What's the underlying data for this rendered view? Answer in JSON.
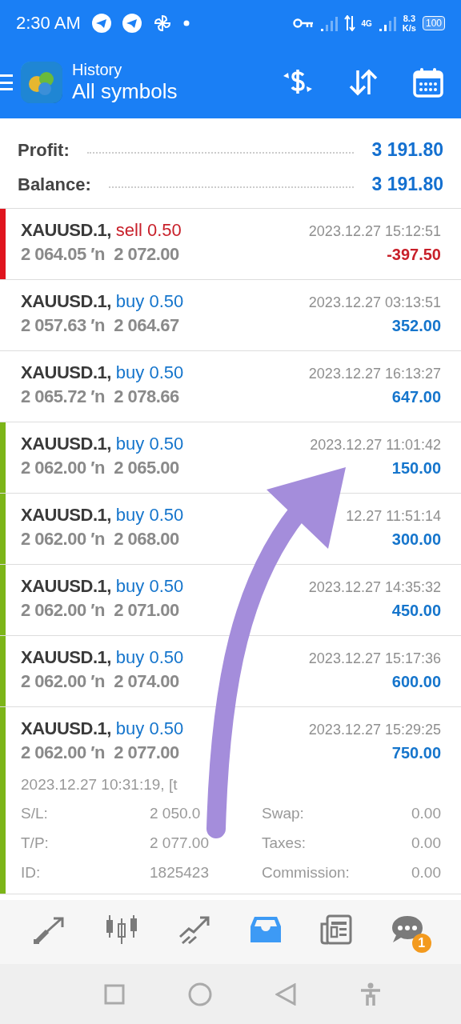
{
  "status_bar": {
    "time": "2:30 AM",
    "speed_value": "8.3",
    "speed_unit": "K/s",
    "network": "4G",
    "battery": "100"
  },
  "header": {
    "subtitle": "History",
    "title": "All symbols"
  },
  "summary": [
    {
      "label": "Profit:",
      "value": "3 191.80"
    },
    {
      "label": "Balance:",
      "value": "3 191.80"
    }
  ],
  "deals": [
    {
      "symbol": "XAUUSD.1,",
      "kind": "sell",
      "order": "sell 0.50",
      "prices": "2 064.05 ′n  2 072.00",
      "time": "2023.12.27 15:12:51",
      "profit": "-397.50",
      "color": "#e0141e",
      "expanded": false
    },
    {
      "symbol": "XAUUSD.1,",
      "kind": "buy",
      "order": "buy 0.50",
      "prices": "2 057.63 ′n  2 064.67",
      "time": "2023.12.27 03:13:51",
      "profit": "352.00",
      "expanded": false
    },
    {
      "symbol": "XAUUSD.1,",
      "kind": "buy",
      "order": "buy 0.50",
      "prices": "2 065.72 ′n  2 078.66",
      "time": "2023.12.27 16:13:27",
      "profit": "647.00",
      "expanded": false
    },
    {
      "symbol": "XAUUSD.1,",
      "kind": "buy",
      "order": "buy 0.50",
      "prices": "2 062.00 ′n  2 065.00",
      "time": "2023.12.27 11:01:42",
      "profit": "150.00",
      "color": "#7cb518",
      "expanded": false
    },
    {
      "symbol": "XAUUSD.1,",
      "kind": "buy",
      "order": "buy 0.50",
      "prices": "2 062.00 ′n  2 068.00",
      "time": "12.27 11:51:14",
      "profit": "300.00",
      "color": "#7cb518",
      "expanded": false
    },
    {
      "symbol": "XAUUSD.1,",
      "kind": "buy",
      "order": "buy 0.50",
      "prices": "2 062.00 ′n  2 071.00",
      "time": "2023.12.27 14:35:32",
      "profit": "450.00",
      "color": "#7cb518",
      "expanded": false
    },
    {
      "symbol": "XAUUSD.1,",
      "kind": "buy",
      "order": "buy 0.50",
      "prices": "2 062.00 ′n  2 074.00",
      "time": "2023.12.27 15:17:36",
      "profit": "600.00",
      "color": "#7cb518",
      "expanded": false
    },
    {
      "symbol": "XAUUSD.1,",
      "kind": "buy",
      "order": "buy 0.50",
      "prices": "2 062.00 ′n  2 077.00",
      "time": "2023.12.27 15:29:25",
      "profit": "750.00",
      "color": "#7cb518",
      "expanded": true,
      "open_info": "2023.12.27 10:31:19, [t",
      "details": [
        {
          "label": "S/L:",
          "value": "2 050.0"
        },
        {
          "label": "Swap:",
          "value": "0.00"
        },
        {
          "label": "T/P:",
          "value": "2 077.00"
        },
        {
          "label": "Taxes:",
          "value": "0.00"
        },
        {
          "label": "ID:",
          "value": "1825423"
        },
        {
          "label": "Commission:",
          "value": "0.00"
        }
      ]
    }
  ],
  "bottom_nav": [
    {
      "kind": "quotes",
      "selected": false
    },
    {
      "kind": "chart",
      "selected": false
    },
    {
      "kind": "trade",
      "selected": false
    },
    {
      "kind": "history",
      "selected": true
    },
    {
      "kind": "news",
      "selected": false
    },
    {
      "kind": "chat",
      "selected": false,
      "badge": "1"
    }
  ]
}
